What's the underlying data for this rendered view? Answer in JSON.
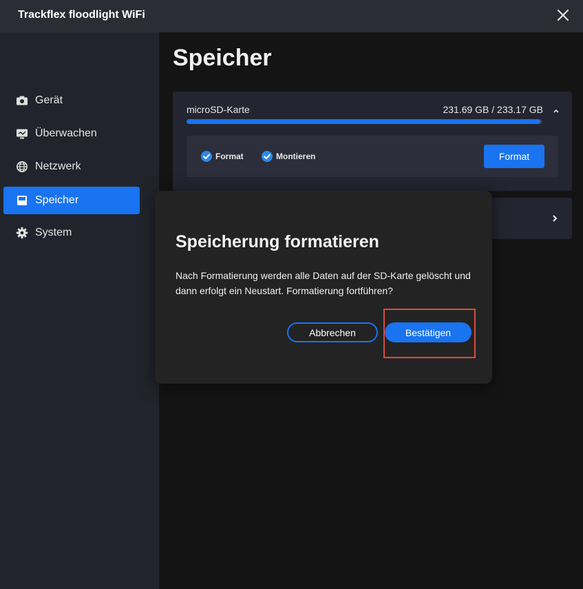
{
  "window": {
    "title": "Trackflex floodlight WiFi"
  },
  "sidebar": {
    "items": [
      {
        "label": "Gerät",
        "icon": "camera-icon",
        "active": false
      },
      {
        "label": "Überwachen",
        "icon": "monitor-icon",
        "active": false
      },
      {
        "label": "Netzwerk",
        "icon": "globe-icon",
        "active": false
      },
      {
        "label": "Speicher",
        "icon": "storage-icon",
        "active": true
      },
      {
        "label": "System",
        "icon": "gear-icon",
        "active": false
      }
    ]
  },
  "main": {
    "title": "Speicher",
    "sd_card": {
      "label": "microSD-Karte",
      "size": "231.69 GB / 233.17 GB",
      "usage_fraction": 0.9937,
      "options": [
        {
          "label": "Format",
          "checked": true
        },
        {
          "label": "Montieren",
          "checked": true
        }
      ],
      "format_button": "Format"
    }
  },
  "dialog": {
    "title": "Speicherung formatieren",
    "message": "Nach Formatierung werden alle Daten auf der SD-Karte gelöscht und dann erfolgt ein Neustart. Formatierung fortführen?",
    "cancel_label": "Abbrechen",
    "confirm_label": "Bestätigen"
  },
  "colors": {
    "accent": "#1a73f0",
    "highlight": "#e04a3e",
    "sidebar_bg": "#21242c",
    "titlebar_bg": "#2a2d35"
  }
}
